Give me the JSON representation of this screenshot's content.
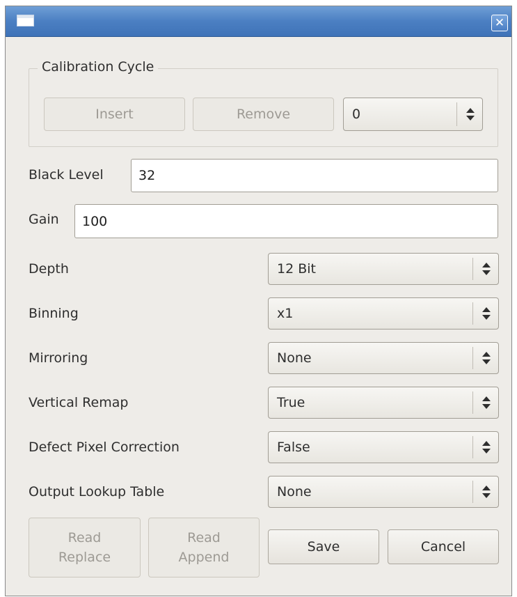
{
  "window": {
    "title": "",
    "close_glyph": "✕"
  },
  "calibration": {
    "group_title": "Calibration Cycle",
    "insert_label": "Insert",
    "remove_label": "Remove",
    "cycle_value": "0"
  },
  "fields": {
    "black_level_label": "Black Level",
    "black_level_value": "32",
    "gain_label": "Gain",
    "gain_value": "100"
  },
  "settings": [
    {
      "label": "Depth",
      "value": "12 Bit"
    },
    {
      "label": "Binning",
      "value": "x1"
    },
    {
      "label": "Mirroring",
      "value": "None"
    },
    {
      "label": "Vertical Remap",
      "value": "True"
    },
    {
      "label": "Defect Pixel Correction",
      "value": "False"
    },
    {
      "label": "Output Lookup Table",
      "value": "None"
    }
  ],
  "buttons": {
    "read_replace_line1": "Read",
    "read_replace_line2": "Replace",
    "read_append_line1": "Read",
    "read_append_line2": "Append",
    "save_label": "Save",
    "cancel_label": "Cancel"
  },
  "icons": {
    "window_icon": "window-icon",
    "close_icon": "close-icon",
    "combo_arrow": "updown-arrows-icon"
  }
}
